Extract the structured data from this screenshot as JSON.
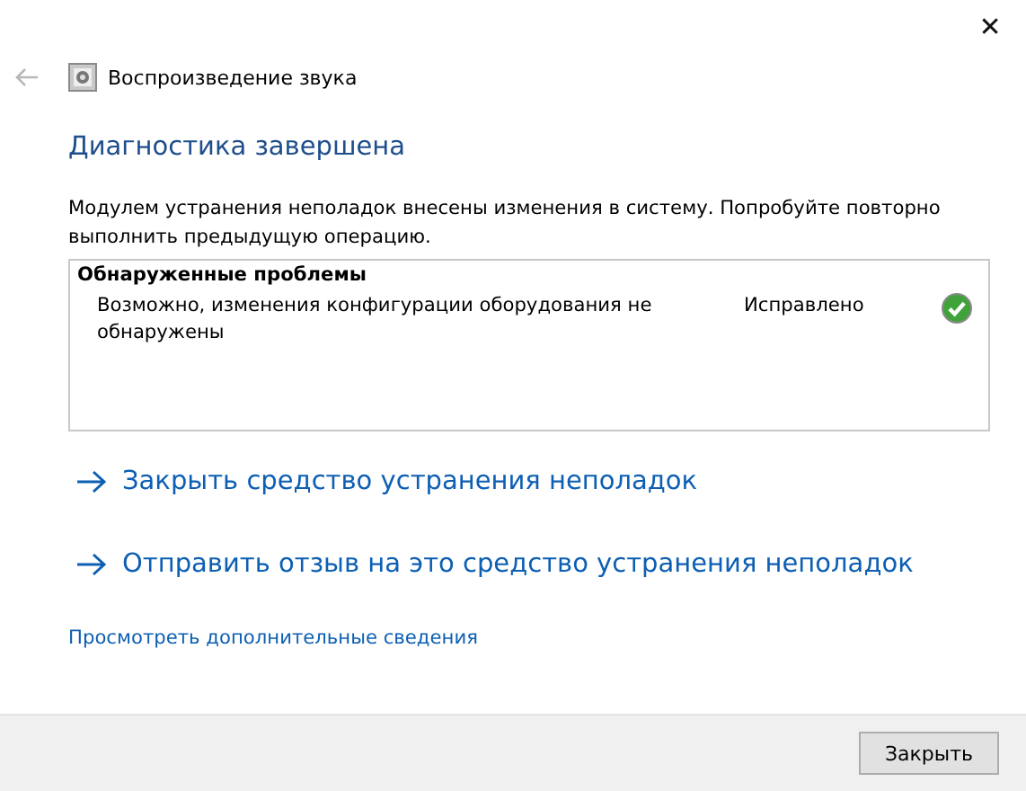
{
  "window": {
    "title": "Воспроизведение звука",
    "close": "✕",
    "back_disabled": true
  },
  "heading": "Диагностика завершена",
  "message": "Модулем устранения неполадок внесены изменения в систему. Попробуйте повторно выполнить предыдущую операцию.",
  "problems": {
    "title": "Обнаруженные проблемы",
    "items": [
      {
        "name": "Возможно, изменения конфигурации оборудования не обнаружены",
        "status": "Исправлено",
        "resolved": true
      }
    ]
  },
  "actions": [
    "Закрыть средство устранения неполадок",
    "Отправить отзыв на это средство устранения неполадок"
  ],
  "details_link": "Просмотреть дополнительные сведения",
  "buttons": [
    "Закрыть"
  ]
}
